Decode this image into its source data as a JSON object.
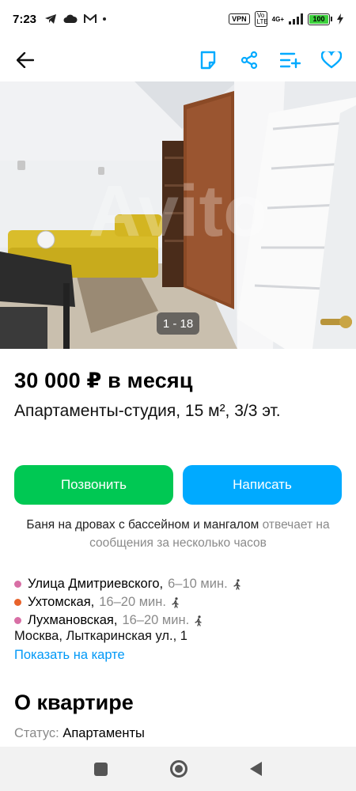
{
  "status_bar": {
    "time": "7:23",
    "vpn": "VPN",
    "volte": "Vo LTE",
    "network": "4G+",
    "battery": "100"
  },
  "toolbar": {
    "back_icon": "arrow-left-icon",
    "note_icon": "note-icon",
    "share_icon": "share-icon",
    "compare_icon": "compare-list-icon",
    "favorite_icon": "heart-icon"
  },
  "gallery": {
    "counter": "1 - 18",
    "watermark": "Avito"
  },
  "listing": {
    "price": "30 000 ₽ в месяц",
    "subtitle": "Апартаменты-студия, 15 м², 3/3 эт."
  },
  "actions": {
    "call_label": "Позвонить",
    "message_label": "Написать"
  },
  "seller": {
    "name": "Баня на дровах с бассейном и мангалом",
    "response_note": "отвечает на сообщения за несколько часов"
  },
  "metro": [
    {
      "station": "Улица Дмитриевского,",
      "distance": "6–10 мин.",
      "color": "#d86fa5"
    },
    {
      "station": "Ухтомская,",
      "distance": "16–20 мин.",
      "color": "#e8632b"
    },
    {
      "station": "Лухмановская,",
      "distance": "16–20 мин.",
      "color": "#d86fa5"
    }
  ],
  "address": "Москва, Лыткаринская ул., 1",
  "map_link": "Показать на карте",
  "about": {
    "heading": "О квартире",
    "status_label": "Статус:",
    "status_value": "Апартаменты"
  },
  "colors": {
    "call_button": "#00c853",
    "message_button": "#00aaff",
    "link": "#0099f7",
    "toolbar_icons": "#00aaff"
  }
}
